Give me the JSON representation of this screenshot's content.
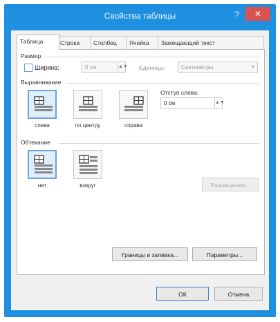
{
  "window": {
    "title": "Свойства таблицы",
    "help_glyph": "?",
    "close_glyph": "✕"
  },
  "tabs": [
    {
      "label": "Таблица",
      "active": true
    },
    {
      "label": "Строка",
      "active": false
    },
    {
      "label": "Столбец",
      "active": false
    },
    {
      "label": "Ячейка",
      "active": false
    },
    {
      "label": "Замещающий текст",
      "active": false
    }
  ],
  "size": {
    "label": "Размер",
    "width_checkbox_label": "Ширина:",
    "width_value": "0 см",
    "units_label": "Единицы:",
    "units_value": "Сантиметры"
  },
  "alignment": {
    "label": "Выравнивание",
    "options": [
      {
        "label": "слева",
        "selected": true
      },
      {
        "label": "по центру",
        "selected": false
      },
      {
        "label": "справа",
        "selected": false
      }
    ],
    "indent_label": "Отступ слева:",
    "indent_value": "0 см"
  },
  "wrap": {
    "label": "Обтекание",
    "options": [
      {
        "label": "нет",
        "selected": true
      },
      {
        "label": "вокруг",
        "selected": false
      }
    ],
    "positioning_button": "Размещение..."
  },
  "buttons": {
    "borders": "Границы и заливка...",
    "options": "Параметры...",
    "ok": "ОК",
    "cancel": "Отмена"
  },
  "colors": {
    "titlebar": "#1f8fe0",
    "close": "#d9534f",
    "selection": "#6ea2d8"
  }
}
